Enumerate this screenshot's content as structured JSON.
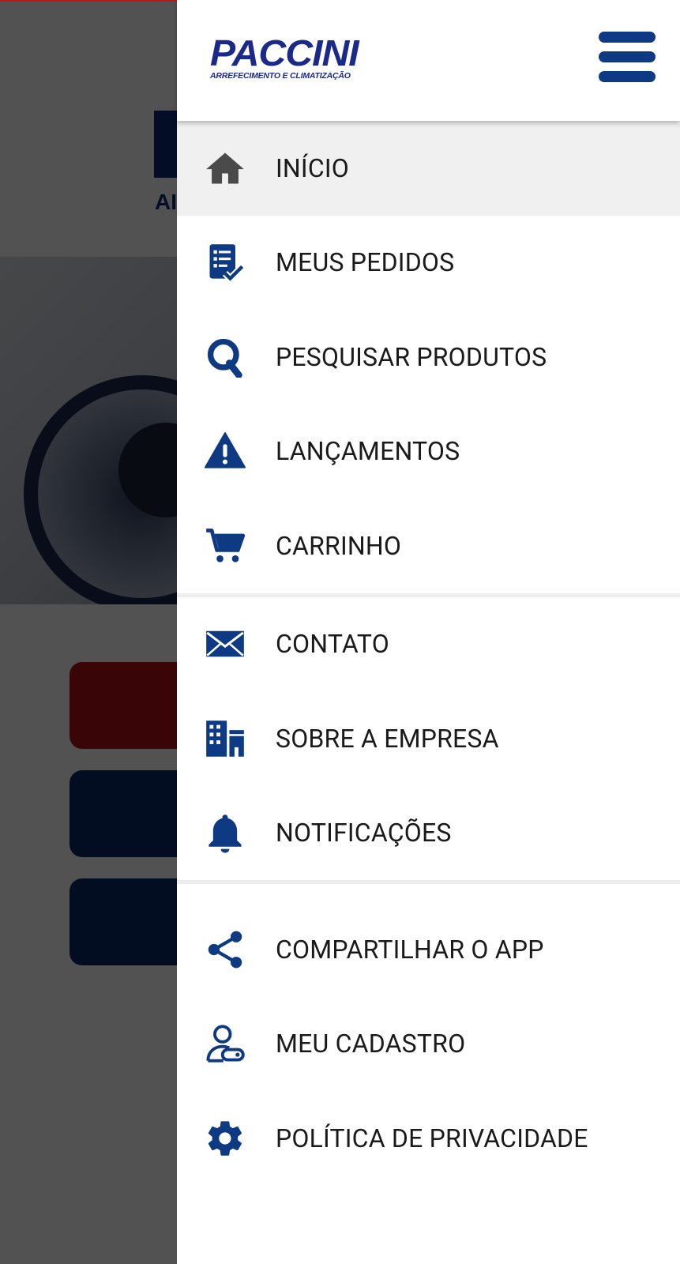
{
  "drawer": {
    "logo": {
      "name": "PACCINI",
      "tagline": "ARREFECIMENTO E CLIMATIZAÇÃO"
    },
    "menu_icon": "hamburger-menu-icon",
    "groups": [
      [
        {
          "label": "INÍCIO",
          "icon": "home-icon",
          "active": true
        },
        {
          "label": "MEUS PEDIDOS",
          "icon": "order-list-icon"
        },
        {
          "label": "PESQUISAR PRODUTOS",
          "icon": "search-icon"
        },
        {
          "label": "LANÇAMENTOS",
          "icon": "warning-icon"
        },
        {
          "label": "CARRINHO",
          "icon": "cart-icon"
        }
      ],
      [
        {
          "label": "CONTATO",
          "icon": "envelope-icon"
        },
        {
          "label": "SOBRE A EMPRESA",
          "icon": "building-icon"
        },
        {
          "label": "NOTIFICAÇÕES",
          "icon": "bell-icon"
        }
      ],
      [
        {
          "label": "COMPARTILHAR O APP",
          "icon": "share-icon"
        },
        {
          "label": "MEU CADASTRO",
          "icon": "user-key-icon"
        },
        {
          "label": "POLÍTICA DE PRIVACIDADE",
          "icon": "gear-icon"
        }
      ]
    ]
  },
  "background": {
    "logo_fragment": "AI"
  },
  "colors": {
    "brand_blue": "#0d3a82",
    "logo_blue": "#1b2a8a",
    "active_bg": "#f0f0f0",
    "accent_red": "#c4141b"
  }
}
